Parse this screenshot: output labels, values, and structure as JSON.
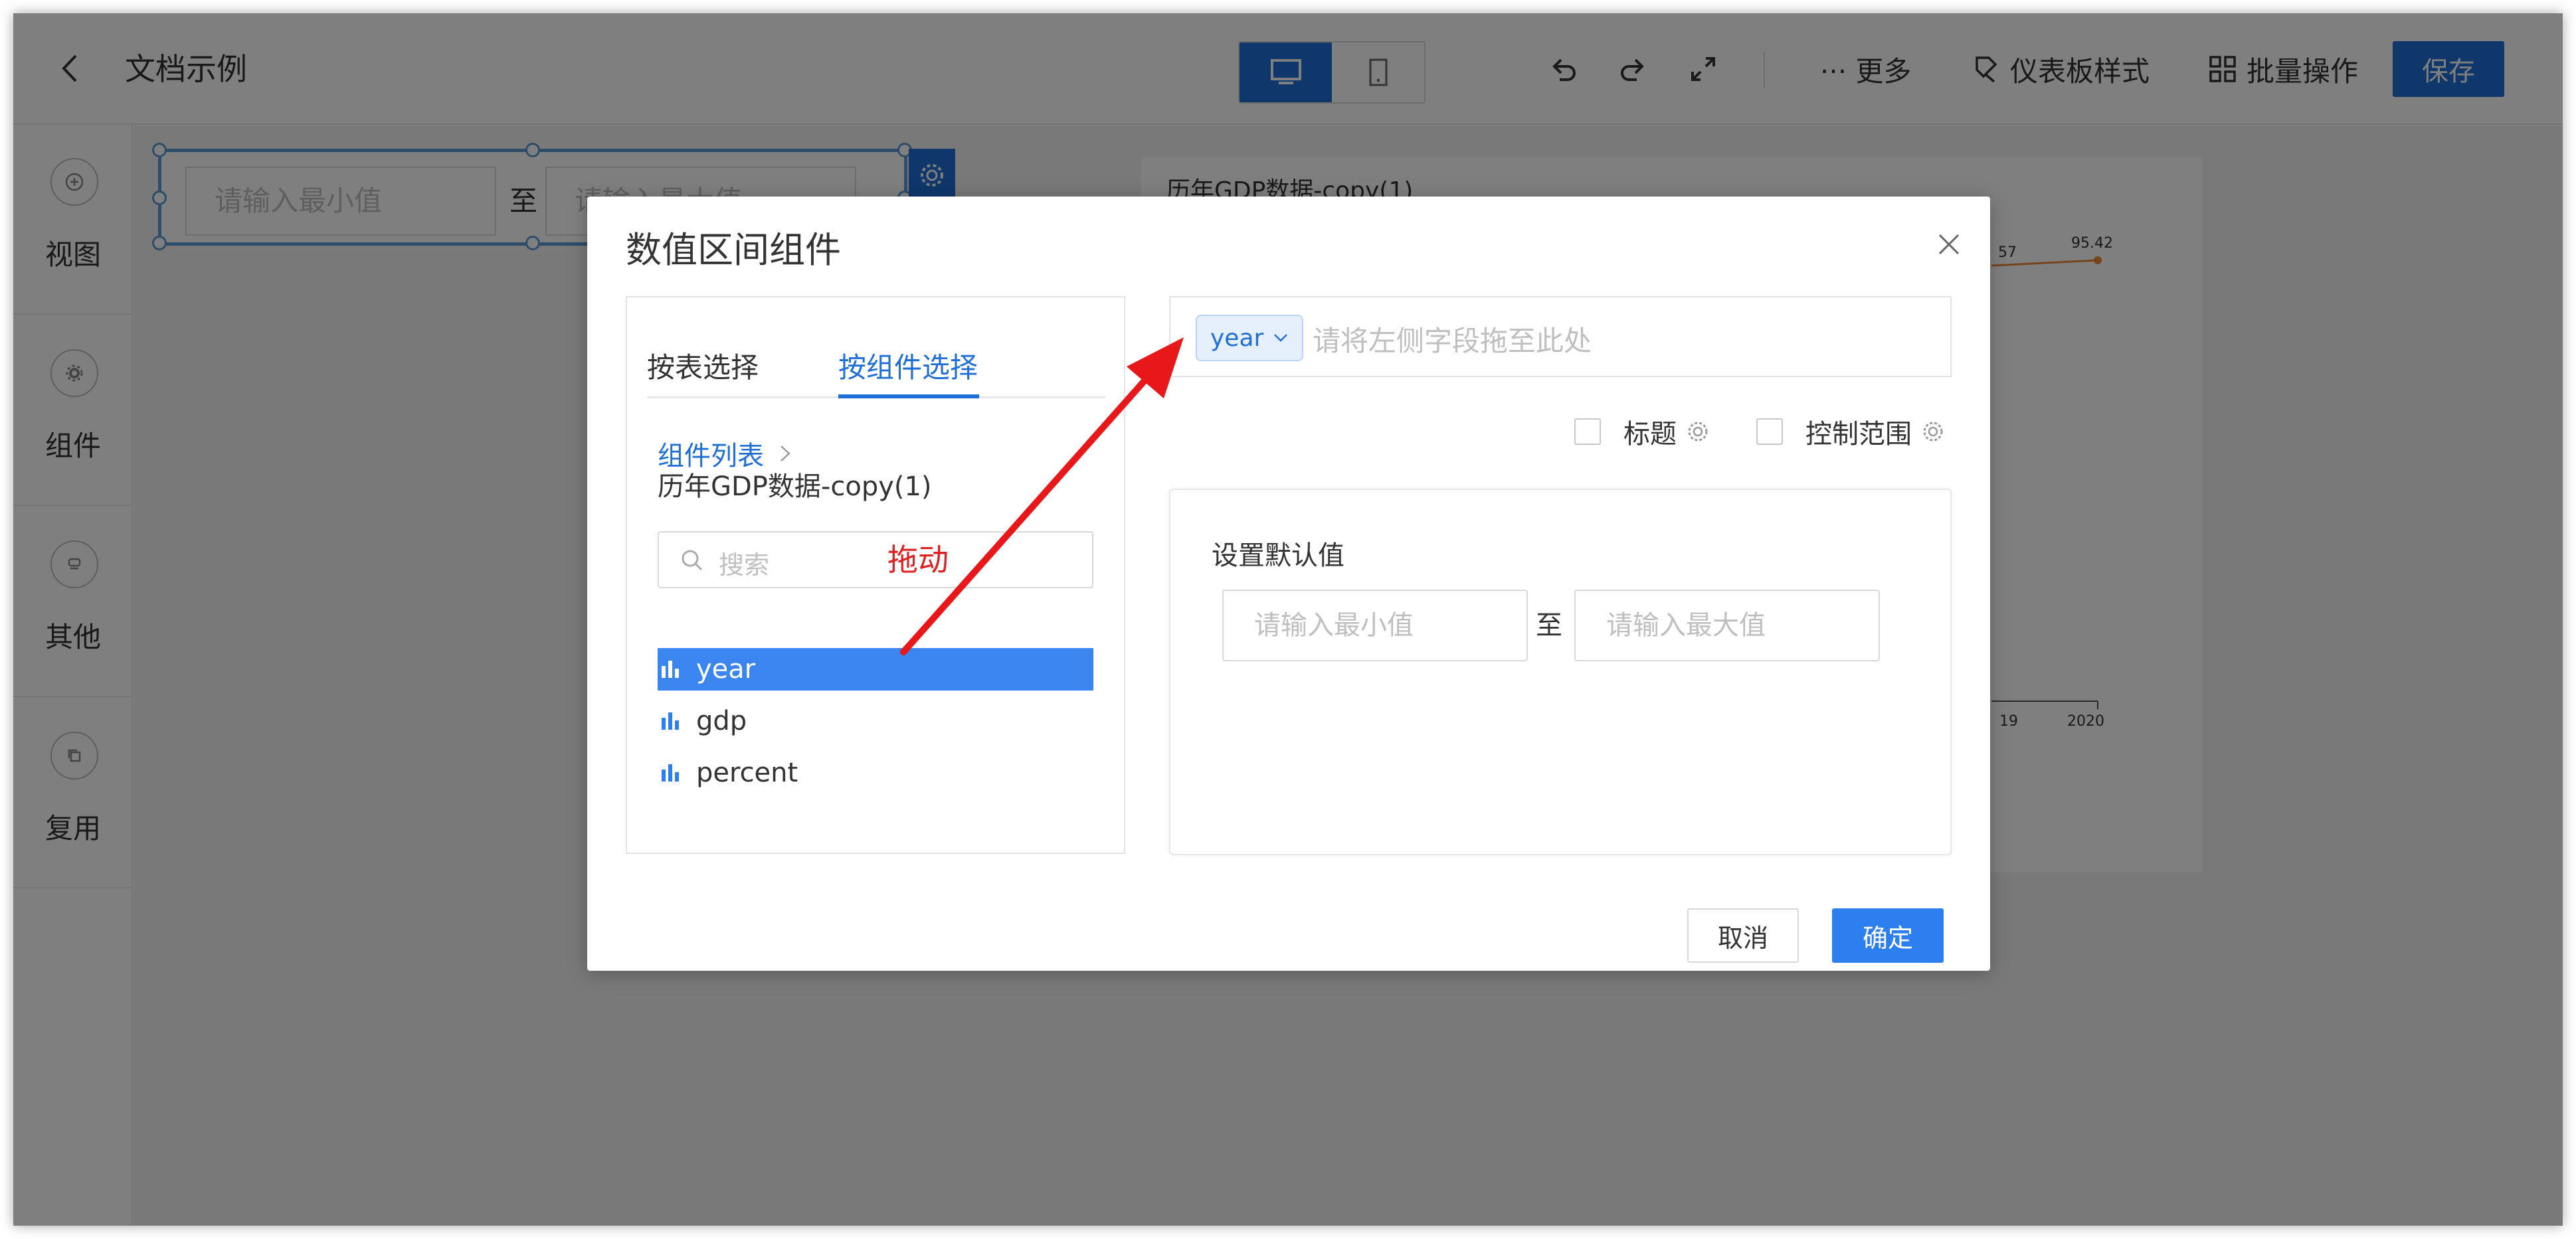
{
  "header": {
    "title": "文档示例",
    "device_desktop": "desktop-icon",
    "device_mobile": "mobile-icon",
    "more_label": "··· 更多",
    "dashboard_style_label": "仪表板样式",
    "batch_label": "批量操作",
    "save_label": "保存"
  },
  "sidebar": {
    "items": [
      {
        "label": "视图",
        "icon": "plus-circle-icon"
      },
      {
        "label": "组件",
        "icon": "gear-icon"
      },
      {
        "label": "其他",
        "icon": "other-icon"
      },
      {
        "label": "复用",
        "icon": "copy-icon"
      }
    ]
  },
  "canvas": {
    "range_min_placeholder": "请输入最小值",
    "range_sep": "至",
    "range_max_placeholder": "请输入最大值",
    "chart_title": "历年GDP数据-copy(1)",
    "chart_value_partial": "57",
    "chart_value": "95.42",
    "chart_axis_partial": "19",
    "chart_axis_last": "2020"
  },
  "modal": {
    "title": "数值区间组件",
    "tabs": [
      {
        "label": "按表选择"
      },
      {
        "label": "按组件选择"
      }
    ],
    "breadcrumb_root": "组件列表",
    "breadcrumb_current": "历年GDP数据-copy(1)",
    "search_placeholder": "搜索",
    "drag_hint": "拖动",
    "fields": [
      {
        "label": "year"
      },
      {
        "label": "gdp"
      },
      {
        "label": "percent"
      }
    ],
    "selected_tag": "year",
    "drop_placeholder": "请将左侧字段拖至此处",
    "option_title": "标题",
    "option_range": "控制范围",
    "default_label": "设置默认值",
    "default_min_placeholder": "请输入最小值",
    "default_sep": "至",
    "default_max_placeholder": "请输入最大值",
    "cancel_label": "取消",
    "confirm_label": "确定"
  },
  "colors": {
    "accent": "#1f6fd7",
    "annotation": "#e02020"
  }
}
